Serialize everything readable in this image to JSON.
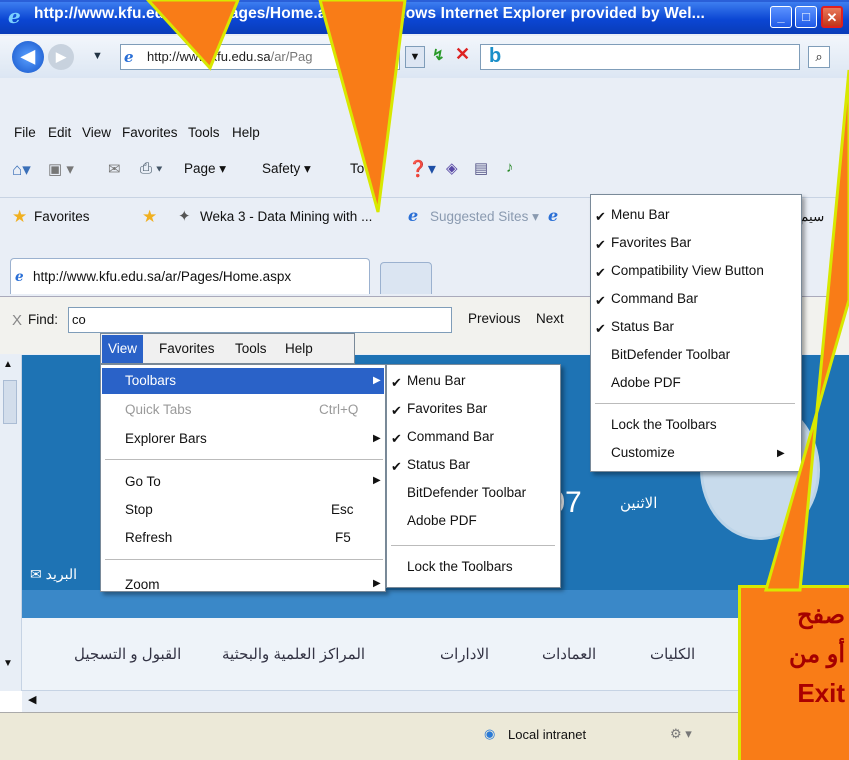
{
  "window": {
    "title": "http://www.kfu.edu.sa/ar/Pages/Home.aspx - Windows Internet Explorer provided by Wel...",
    "ie_logo": "ie-logo-icon",
    "min": "minimize-icon",
    "max": "maximize-icon",
    "close": "close-icon"
  },
  "address_bar": {
    "url_domain": "http://www.kfu.edu.sa",
    "url_rest": "/ar/Pag",
    "search_value": ""
  },
  "menubar": {
    "items": [
      "File",
      "Edit",
      "View",
      "Favorites",
      "Tools",
      "Help"
    ]
  },
  "commandbar": {
    "page": "Page",
    "safety": "Safety",
    "tools": "To"
  },
  "favorites_bar": {
    "favorites_label": "Favorites",
    "weka": "Weka 3 - Data Mining with ...",
    "suggested": "Suggested Sites",
    "extra": "سيم"
  },
  "tab": {
    "title": "http://www.kfu.edu.sa/ar/Pages/Home.aspx"
  },
  "findbar": {
    "close": "X",
    "label": "Find:",
    "value": "co",
    "previous": "Previous",
    "next": "Next"
  },
  "page": {
    "date": "/07",
    "day": "الاثنين",
    "mail": "البريد",
    "nav": [
      "القبول و التسجيل",
      "المراكز العلمية والبحثية",
      "الادارات",
      "العمادات",
      "الكليات"
    ]
  },
  "view_menu": {
    "header": [
      "View",
      "Favorites",
      "Tools",
      "Help"
    ],
    "items": [
      {
        "label": "Toolbars",
        "shortcut": "",
        "submenu": true,
        "selected": true,
        "disabled": false
      },
      {
        "label": "Quick Tabs",
        "shortcut": "Ctrl+Q",
        "submenu": false,
        "selected": false,
        "disabled": true
      },
      {
        "label": "Explorer Bars",
        "shortcut": "",
        "submenu": true,
        "selected": false,
        "disabled": false
      },
      {
        "label": "Go To",
        "shortcut": "",
        "submenu": true,
        "selected": false,
        "disabled": false
      },
      {
        "label": "Stop",
        "shortcut": "Esc",
        "submenu": false,
        "selected": false,
        "disabled": false
      },
      {
        "label": "Refresh",
        "shortcut": "F5",
        "submenu": false,
        "selected": false,
        "disabled": false
      },
      {
        "label": "Zoom",
        "shortcut": "",
        "submenu": true,
        "selected": false,
        "disabled": false
      }
    ]
  },
  "toolbars_submenu": {
    "items": [
      {
        "label": "Menu Bar",
        "checked": true
      },
      {
        "label": "Favorites Bar",
        "checked": true
      },
      {
        "label": "Command Bar",
        "checked": true
      },
      {
        "label": "Status Bar",
        "checked": true
      },
      {
        "label": "BitDefender Toolbar",
        "checked": false
      },
      {
        "label": "Adobe PDF",
        "checked": false
      },
      {
        "label": "Lock the Toolbars",
        "checked": false
      }
    ]
  },
  "context_menu": {
    "items": [
      {
        "label": "Menu Bar",
        "checked": true
      },
      {
        "label": "Favorites Bar",
        "checked": true
      },
      {
        "label": "Compatibility View Button",
        "checked": true
      },
      {
        "label": "Command Bar",
        "checked": true
      },
      {
        "label": "Status Bar",
        "checked": true
      },
      {
        "label": "BitDefender Toolbar",
        "checked": false
      },
      {
        "label": "Adobe PDF",
        "checked": false
      },
      {
        "label": "Lock the Toolbars",
        "checked": false
      },
      {
        "label": "Customize",
        "checked": false
      }
    ]
  },
  "statusbar": {
    "zone": "Local intranet"
  },
  "callout": {
    "line1": "صفح",
    "line2": "أو من",
    "line3": "Exit"
  },
  "colors": {
    "titlebar": "#0b46d3",
    "menu_highlight": "#2a62c8",
    "callout": "#f97c17",
    "page": "#1e73b4"
  }
}
